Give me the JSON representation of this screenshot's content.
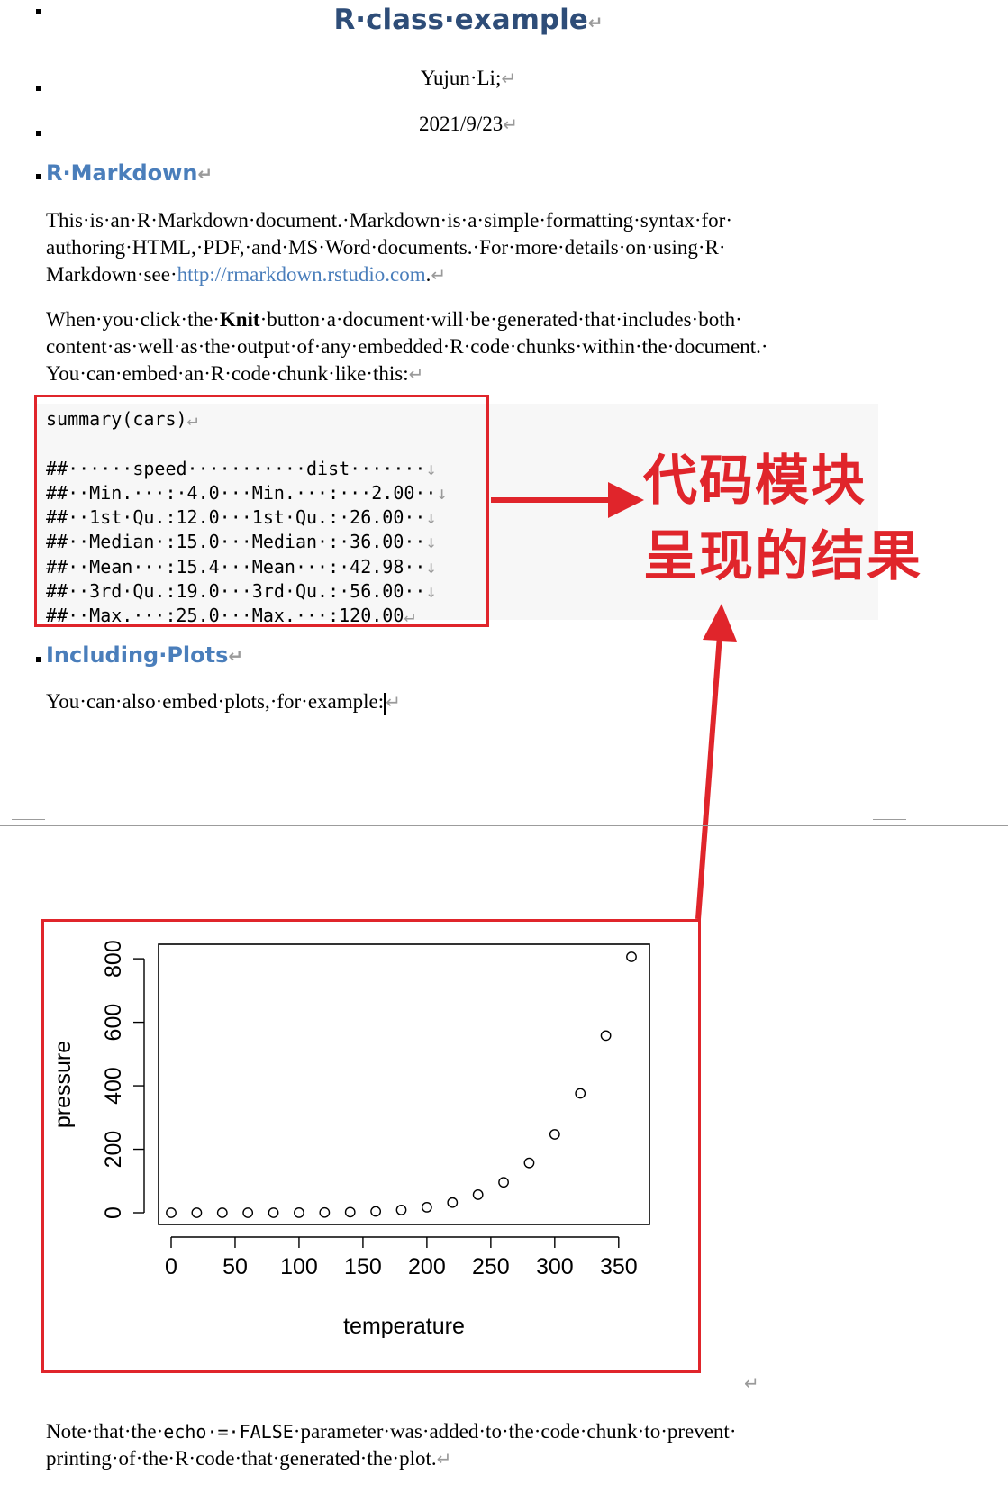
{
  "document": {
    "title": "R·class·example",
    "author": "Yujun·Li;",
    "date": "2021/9/23"
  },
  "marks": {
    "para": "↵",
    "line_break": "↓"
  },
  "section1": {
    "heading": "R·Markdown",
    "p1": {
      "line1": "This·is·an·R·Markdown·document.·Markdown·is·a·simple·formatting·syntax·for·",
      "line2": "authoring·HTML,·PDF,·and·MS·Word·documents.·For·more·details·on·using·R·",
      "line3_prefix": "Markdown·see·",
      "link": "http://rmarkdown.rstudio.com",
      "line3_suffix": "."
    },
    "p2": {
      "line1_prefix": "When·you·click·the·",
      "bold": "Knit",
      "line1_suffix": "·button·a·document·will·be·generated·that·includes·both·",
      "line2": "content·as·well·as·the·output·of·any·embedded·R·code·chunks·within·the·document.·",
      "line3": "You·can·embed·an·R·code·chunk·like·this:"
    },
    "code_call": "summary(cars)",
    "code_output": [
      "##······speed···········dist·······",
      "##··Min.···:·4.0···Min.···:···2.00··",
      "##··1st·Qu.:12.0···1st·Qu.:·26.00··",
      "##··Median·:15.0···Median·:·36.00··",
      "##··Mean···:15.4···Mean···:·42.98··",
      "##··3rd·Qu.:19.0···3rd·Qu.:·56.00··",
      "##··Max.···:25.0···Max.···:120.00"
    ]
  },
  "annotation": {
    "line1": "代码模块",
    "line2": "呈现的结果",
    "color": "#e0252b"
  },
  "section2": {
    "heading": "Including·Plots",
    "p1": "You·can·also·embed·plots,·for·example:"
  },
  "note": {
    "line1_prefix": "Note·that·the·",
    "code1": "echo",
    "mid": "·=·",
    "code2": "FALSE",
    "line1_suffix": "·parameter·was·added·to·the·code·chunk·to·prevent·",
    "line2": "printing·of·the·R·code·that·generated·the·plot."
  },
  "chart_data": {
    "type": "scatter",
    "xlabel": "temperature",
    "ylabel": "pressure",
    "xlim": [
      0,
      360
    ],
    "ylim": [
      0,
      806
    ],
    "xticks": [
      0,
      50,
      100,
      150,
      200,
      250,
      300,
      350
    ],
    "yticks": [
      0,
      200,
      400,
      600,
      800
    ],
    "marker": "open-circle",
    "x": [
      0,
      20,
      40,
      60,
      80,
      100,
      120,
      140,
      160,
      180,
      200,
      220,
      240,
      260,
      280,
      300,
      320,
      340,
      360
    ],
    "y": [
      0.0002,
      0.0012,
      0.006,
      0.03,
      0.09,
      0.27,
      0.75,
      1.85,
      4.2,
      8.8,
      17.3,
      32.1,
      57,
      96,
      157,
      247,
      376,
      558,
      806
    ]
  }
}
